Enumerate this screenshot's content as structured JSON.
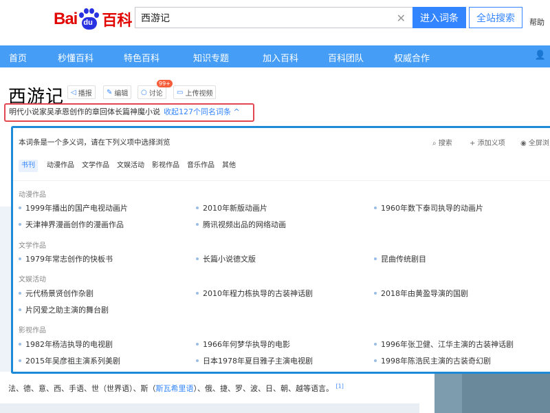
{
  "header": {
    "logo_bai": "Bai",
    "logo_du": "du",
    "logo_baike": "百科",
    "search_value": "西游记",
    "enter_label": "进入词条",
    "site_search_label": "全站搜索",
    "help_label": "帮助"
  },
  "nav": {
    "items": [
      "首页",
      "秒懂百科",
      "特色百科",
      "知识专题",
      "加入百科",
      "百科团队",
      "权威合作"
    ]
  },
  "entry": {
    "title": "西游记",
    "tools": {
      "broadcast": "播报",
      "edit": "编辑",
      "discuss": "讨论",
      "badge": "99+",
      "upload": "上传视频"
    },
    "subtitle": "明代小说家吴承恩创作的章回体长篇神魔小说",
    "collapse": "收起127个同名词条 ^"
  },
  "polysemy": {
    "intro": "本词条是一个多义词，请在下列义项中选择浏览",
    "search": "搜索",
    "add": "添加义项",
    "fullscreen": "全屏浏览",
    "tabs": [
      "书刊",
      "动漫作品",
      "文学作品",
      "文娱活动",
      "影视作品",
      "音乐作品",
      "其他"
    ],
    "categories": [
      {
        "title": "动漫作品",
        "items": [
          "1999年播出的国产电视动画片",
          "2010年新版动画片",
          "1960年数下泰司执导的动画片",
          "天津神界漫画创作的漫画作品",
          "腾讯视频出品的网络动画"
        ]
      },
      {
        "title": "文学作品",
        "items": [
          "1979年常志创作的快板书",
          "长篇小说德文版",
          "昆曲传统剧目"
        ]
      },
      {
        "title": "文娱活动",
        "items": [
          "元代杨景贤创作杂剧",
          "2010年程力栋执导的古装神话剧",
          "2018年由黄盈导演的国剧",
          "片冈爱之助主演的舞台剧"
        ]
      },
      {
        "title": "影视作品",
        "items": [
          "1982年杨洁执导的电视剧",
          "1966年何梦华执导的电影",
          "1996年张卫健、江华主演的古装神话剧",
          "2015年吴彦祖主演系列美剧",
          "日本1978年夏目雅子主演电视剧",
          "1998年陈浩民主演的古装奇幻剧"
        ]
      }
    ]
  },
  "body": {
    "text_pre": "法、德、意、西、手语、世（世界语）、斯（",
    "text_link": "斯瓦希里语",
    "text_post": "）、俄、捷、罗、波、日、朝、越等语言。",
    "ref": "[1]"
  },
  "colors": {
    "nav": "#459df5",
    "accent": "#3385ff",
    "highlight_red": "#e2474f",
    "panel_border": "#1c8ad7"
  }
}
